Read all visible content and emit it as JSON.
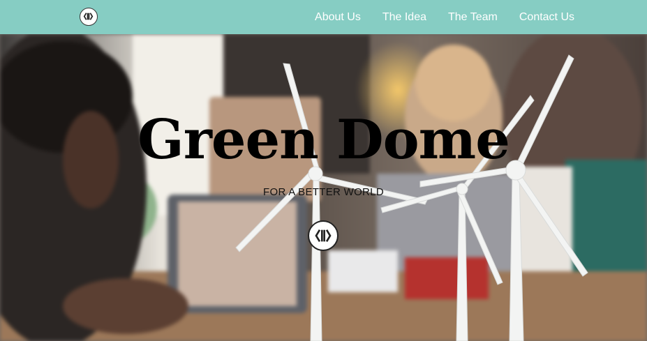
{
  "nav": {
    "logo_icon": "kk-logo-icon",
    "links": [
      {
        "label": "About Us"
      },
      {
        "label": "The Idea"
      },
      {
        "label": "The Team"
      },
      {
        "label": "Contact Us"
      }
    ]
  },
  "hero": {
    "title": "Green Dome",
    "subtitle": "FOR A BETTER WORLD",
    "logo_icon": "kk-logo-icon"
  },
  "colors": {
    "navbar": "#86cdc3",
    "nav_text": "#ffffff",
    "title": "#000000"
  }
}
